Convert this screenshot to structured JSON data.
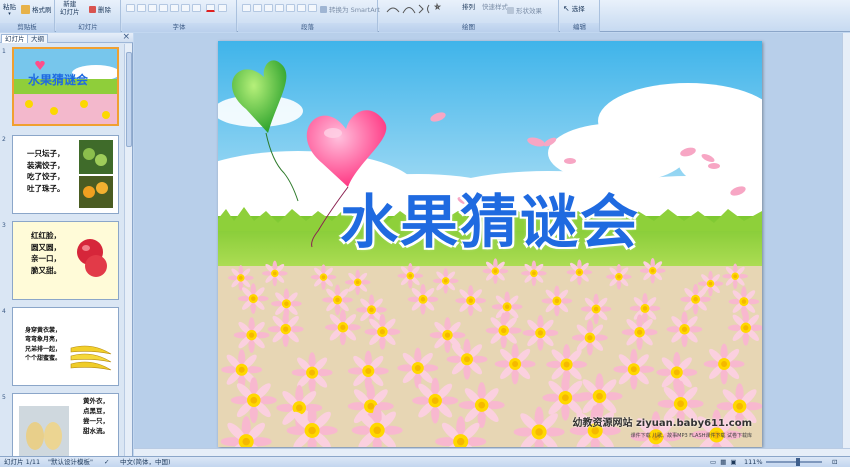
{
  "ribbon": {
    "groups": {
      "clipboard": "剪贴板",
      "slides": "幻灯片",
      "font": "字体",
      "paragraph": "段落",
      "drawing": "绘图",
      "editing": "编辑"
    },
    "paste": "粘贴",
    "format_painter": "格式刷",
    "new_slide_line1": "新建",
    "new_slide_line2": "幻灯片",
    "delete": "删除",
    "smartart": "转换为 SmartArt",
    "arrange": "排列",
    "quick_styles": "快速样式",
    "shape_effects": "形状效果",
    "select": "选择"
  },
  "left_pane": {
    "tab_slides": "幻灯片",
    "tab_outline": "大纲",
    "close": "×",
    "thumbs": [
      {
        "num": "1",
        "title": "水果猜谜会"
      },
      {
        "num": "2",
        "text": "一只坛子，\n装满饺子，\n吃了饺子，\n吐了珠子。"
      },
      {
        "num": "3",
        "text": "红红脸，\n圆又圆，\n亲一口，\n脆又甜。"
      },
      {
        "num": "4",
        "text": "身穿黄衣裳，\n弯弯象月亮，\n兄弟排一起，\n个个甜蜜蜜。"
      },
      {
        "num": "5",
        "text": "黄外衣，\n点黑豆，\n尝一只，\n甜水流。"
      }
    ]
  },
  "slide": {
    "title": "水果猜谜会",
    "watermark": "幼教资源网站  ziyuan.baby611.com",
    "watermark_sub": "课件下载  儿歌、故事MP3  FLASH课件下载  试卷下载库"
  },
  "status": {
    "slide_counter": "幻灯片 1/11",
    "theme": "\"默认设计模板\"",
    "language": "中文(简体，中国)",
    "zoom": "111%"
  }
}
